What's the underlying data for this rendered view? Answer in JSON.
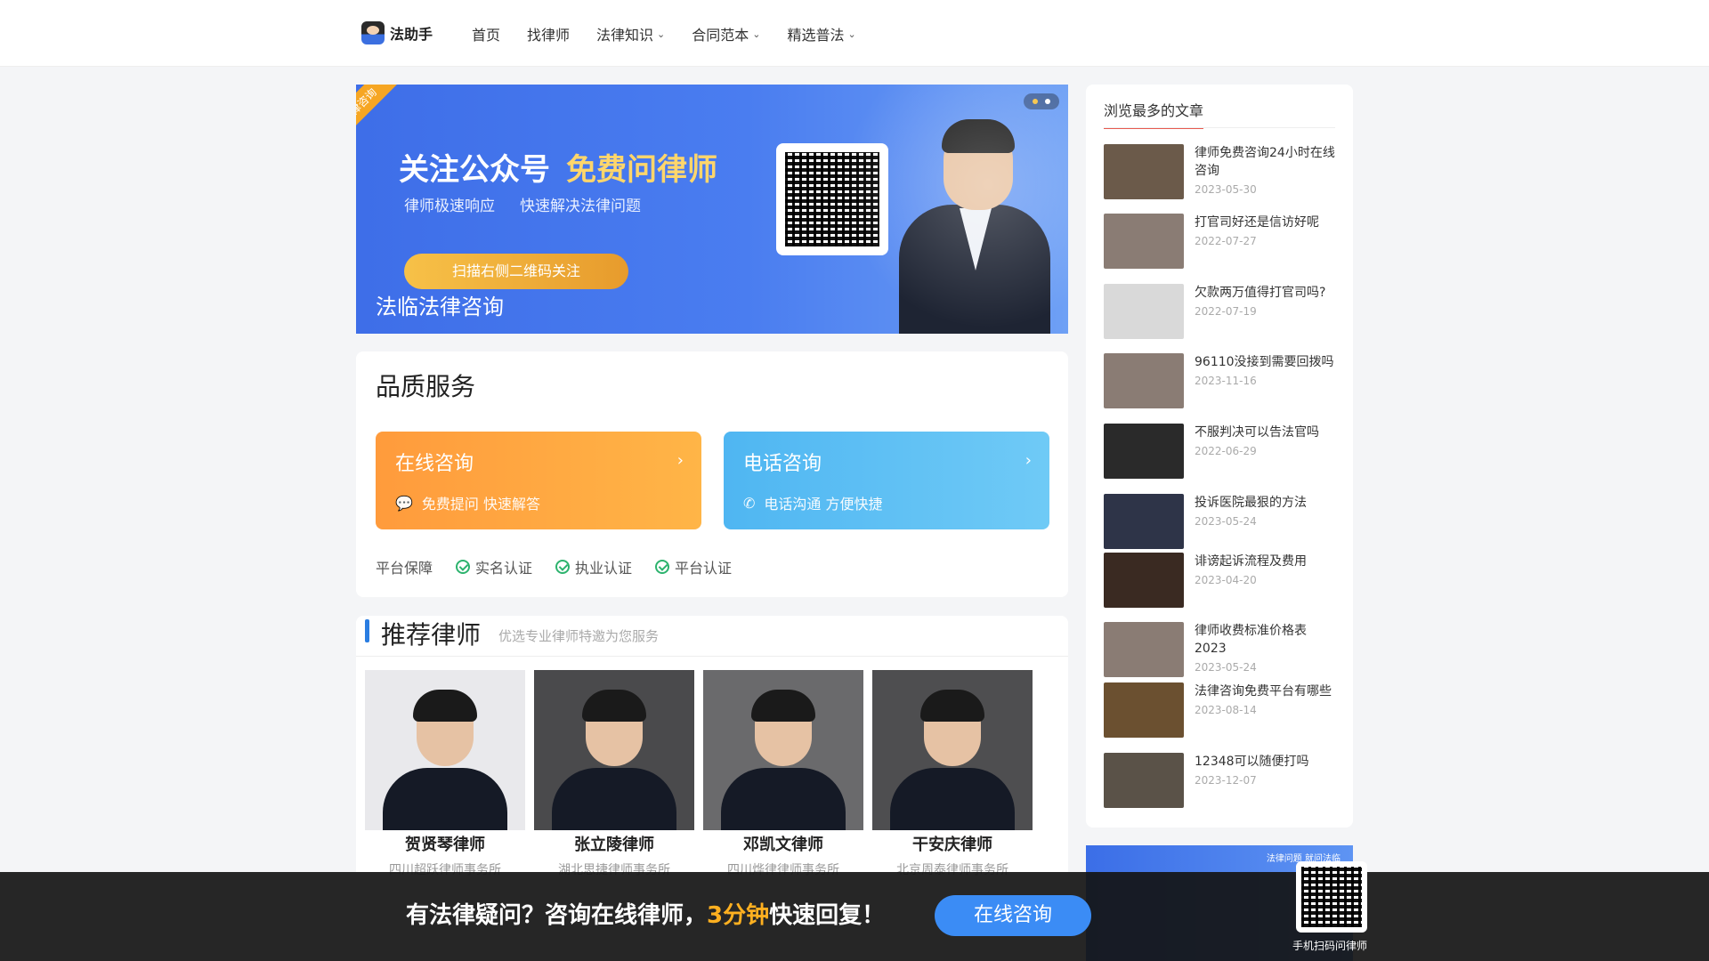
{
  "header": {
    "logo_text": "法助手",
    "nav": [
      {
        "label": "首页",
        "has_menu": false
      },
      {
        "label": "找律师",
        "has_menu": false
      },
      {
        "label": "法律知识",
        "has_menu": true
      },
      {
        "label": "合同范本",
        "has_menu": true
      },
      {
        "label": "精选普法",
        "has_menu": true
      }
    ]
  },
  "banner": {
    "ribbon": "法律咨询",
    "title_a": "关注公众号",
    "title_b": "免费问律师",
    "sub_a": "律师极速响应",
    "sub_b": "快速解决法律问题",
    "button": "扫描右侧二维码关注",
    "caption": "法临法律咨询"
  },
  "quality": {
    "title": "品质服务",
    "online": {
      "title": "在线咨询",
      "sub": "免费提问 快速解答"
    },
    "phone": {
      "title": "电话咨询",
      "sub": "电话沟通 方便快捷"
    },
    "guarantee_label": "平台保障",
    "guarantees": [
      "实名认证",
      "执业认证",
      "平台认证"
    ]
  },
  "lawyers": {
    "title": "推荐律师",
    "subtitle": "优选专业律师特邀为您服务",
    "items": [
      {
        "name": "贺贤琴律师",
        "firm": "四川超跃律师事务所"
      },
      {
        "name": "张立陵律师",
        "firm": "湖北思捷律师事务所"
      },
      {
        "name": "邓凯文律师",
        "firm": "四川烨律律师事务所"
      },
      {
        "name": "干安庆律师",
        "firm": "北京周泰律师事务所"
      }
    ]
  },
  "sidebar": {
    "title": "浏览最多的文章",
    "articles": [
      {
        "title": "律师免费咨询24小时在线咨询",
        "date": "2023-05-30",
        "thumb_color": "#6b5a4a"
      },
      {
        "title": "打官司好还是信访好呢",
        "date": "2022-07-27",
        "thumb_color": "#8a7c74"
      },
      {
        "title": "欠款两万值得打官司吗?",
        "date": "2022-07-19",
        "thumb_color": "#d9d9d9"
      },
      {
        "title": "96110没接到需要回拨吗",
        "date": "2023-11-16",
        "thumb_color": "#8a7c74"
      },
      {
        "title": "不服判决可以告法官吗",
        "date": "2022-06-29",
        "thumb_color": "#2a2a2a"
      },
      {
        "title": "投诉医院最狠的方法",
        "date": "2023-05-24",
        "thumb_color": "#2e3448"
      },
      {
        "title": "诽谤起诉流程及费用",
        "date": "2023-04-20",
        "thumb_color": "#3a2a22"
      },
      {
        "title": "律师收费标准价格表2023",
        "date": "2023-05-24",
        "thumb_color": "#8a7c74"
      },
      {
        "title": "法律咨询免费平台有哪些",
        "date": "2023-08-14",
        "thumb_color": "#6b5030"
      },
      {
        "title": "12348可以随便打吗",
        "date": "2023-12-07",
        "thumb_color": "#5a5248"
      }
    ],
    "ad_tag": "法律问题 就问法临"
  },
  "bottom_bar": {
    "text_a": "有法律疑问？咨询在线律师，",
    "text_hl": "3分钟",
    "text_b": "快速回复！",
    "button": "在线咨询",
    "qr_label": "手机扫码问律师"
  }
}
